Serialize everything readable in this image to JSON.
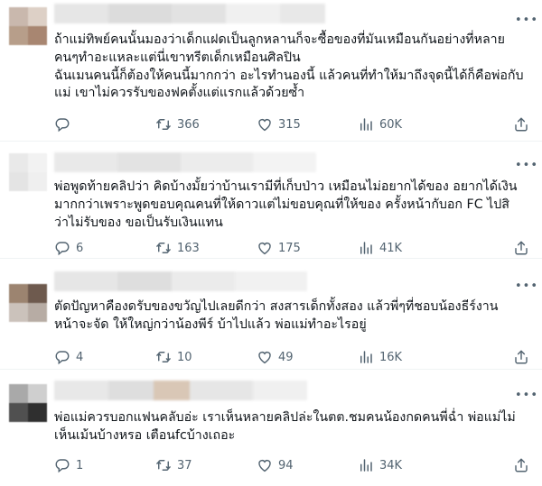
{
  "colors": {
    "text": "#0f1419",
    "secondary": "#536471",
    "divider": "#eff3f4"
  },
  "icons": {
    "reply": "reply-icon",
    "retweet": "retweet-icon",
    "like": "heart-icon",
    "views": "bar-chart-icon",
    "share": "share-icon",
    "more": "more-icon"
  },
  "tweets": [
    {
      "lines": [
        "ถ้าแม่ทิพย์คนนั้นมองว่าเด็กแฝดเป็นลูกหลานก็จะซื้อของที่มันเหมือนกันอย่างที่หลาย",
        "คนๆทำอะแหละแต่นี่เขาทรีตเด็กเหมือนศิลปิน",
        "ฉันเมนคนนี้ก็ต้องให้คนนี้มากกว่า อะไรทำนองนี้ แล้วคนที่ทำให้มาถึงจุดนี้ได้ก็คือพ่อกับ",
        "แม่ เขาไม่ควรรับของฟคตั้งแต่แรกแล้วด้วยซ้ำ"
      ],
      "replies": "",
      "retweets": "366",
      "likes": "315",
      "views": "60K"
    },
    {
      "lines": [
        "พ่อพูดท้ายคลิปว่า คิดบ้างมั้ยว่าบ้านเรามีที่เก็บป่าว เหมือนไม่อยากได้ของ อยากได้เงิน",
        "มากกว่าเพราะพูดขอบคุณคนที่ให้ดาวแต่ไม่ขอบคุณที่ให้ของ ครั้งหน้ากับอก FC ไปสิ",
        "ว่าไม่รับของ ขอเป็นรับเงินแทน"
      ],
      "replies": "6",
      "retweets": "163",
      "likes": "175",
      "views": "41K"
    },
    {
      "lines": [
        "ตัดปัญหาคืองดรับของขวัญไปเลยดีกว่า สงสารเด็กทั้งสอง แล้วพี่ๆที่ชอบน้องธีร์งาน",
        "หน้าจะจัด ให้ใหญ่กว่าน้องพีร์ บ้าไปแล้ว พ่อแม่ทำอะไรอยู่"
      ],
      "replies": "4",
      "retweets": "10",
      "likes": "49",
      "views": "16K"
    },
    {
      "lines": [
        "พ่อแม่ควรบอกแฟนคลับอ่ะ เราเห็นหลายคลิปล่ะในตต.ชมคนน้องกดคนพี่ฉ่ำ พ่อแม่ไม่",
        "เห็นเม้นบ้างหรอ เตือนfcบ้างเถอะ"
      ],
      "replies": "1",
      "retweets": "37",
      "likes": "94",
      "views": "34K"
    }
  ]
}
